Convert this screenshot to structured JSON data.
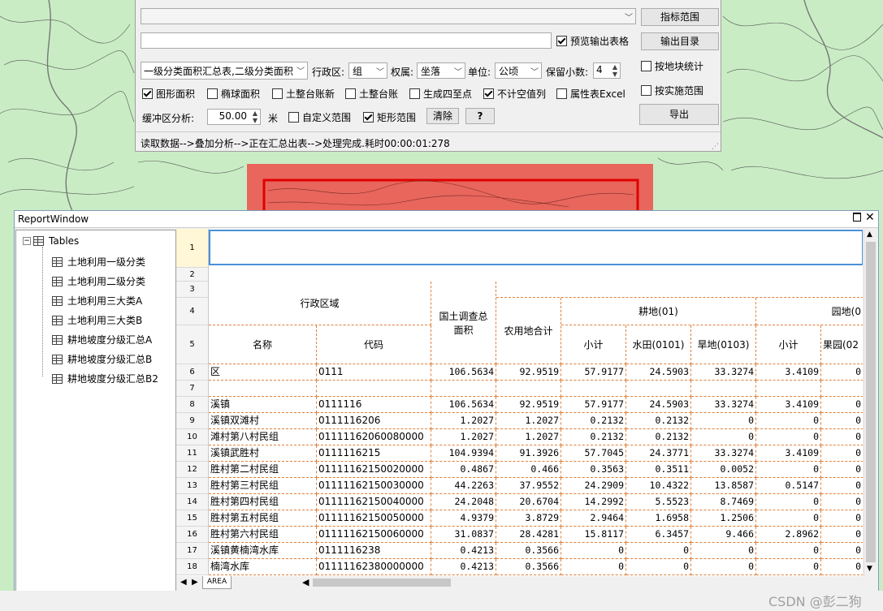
{
  "panel": {
    "preview_checkbox": "预览输出表格",
    "btn_index_range": "指标范围",
    "btn_output_dir": "输出目录",
    "report_select": "一级分类面积汇总表,二级分类面积",
    "admin_label": "行政区:",
    "admin_select": "组",
    "owner_label": "权属:",
    "owner_select": "坐落",
    "unit_label": "单位:",
    "unit_select": "公顷",
    "decimals_label": "保留小数:",
    "decimals_value": "4",
    "cb_block_stats": "按地块统计",
    "cb_shape_area": "图形面积",
    "cb_ellipsoid_area": "椭球面积",
    "cb_land_ledger_new": "土整台账新",
    "cb_land_ledger": "土整台账",
    "cb_four_bounds": "生成四至点",
    "cb_skip_empty": "不计空值列",
    "cb_attr_excel": "属性表Excel",
    "cb_impl_range": "按实施范围",
    "buffer_label": "缓冲区分析:",
    "buffer_value": "50.00",
    "buffer_unit": "米",
    "cb_custom_range": "自定义范围",
    "cb_rect_range": "矩形范围",
    "btn_clear": "清除",
    "btn_help": "?",
    "btn_export": "导出",
    "status": "读取数据-->叠加分析-->正在汇总出表-->处理完成.耗时00:00:01:278"
  },
  "report_window": {
    "title": "ReportWindow",
    "tree_root": "Tables",
    "tree_items": [
      "土地利用一级分类",
      "土地利用二级分类",
      "土地利用三大类A",
      "土地利用三大类B",
      "耕地坡度分级汇总A",
      "耕地坡度分级汇总B",
      "耕地坡度分级汇总B2"
    ],
    "sheet_tab": "AREA"
  },
  "table": {
    "row_numbers": [
      "1",
      "2",
      "3",
      "4",
      "5",
      "6",
      "7",
      "8",
      "9",
      "10",
      "11",
      "12",
      "13",
      "14",
      "15",
      "16",
      "17",
      "18"
    ],
    "h_region": "行政区域",
    "h_name": "名称",
    "h_code": "代码",
    "h_survey": "国土调查总面积",
    "h_agri": "农用地合计",
    "h_arable": "耕地(01)",
    "h_subtotal": "小计",
    "h_paddy": "水田(0101)",
    "h_dry": "旱地(0103)",
    "h_garden": "园地(0",
    "h_subtotal2": "小计",
    "h_orchard": "果园(02",
    "rows": [
      {
        "name": "区",
        "code": "0111",
        "survey": "106.5634",
        "agri": "92.9519",
        "sub": "57.9177",
        "paddy": "24.5903",
        "dry": "33.3274",
        "gsub": "3.4109",
        "orch": "0"
      },
      {
        "name": "",
        "code": "",
        "survey": "",
        "agri": "",
        "sub": "",
        "paddy": "",
        "dry": "",
        "gsub": "",
        "orch": ""
      },
      {
        "name": "溪镇",
        "code": "0111116",
        "survey": "106.5634",
        "agri": "92.9519",
        "sub": "57.9177",
        "paddy": "24.5903",
        "dry": "33.3274",
        "gsub": "3.4109",
        "orch": "0"
      },
      {
        "name": "溪镇双滩村",
        "code": "0111116206",
        "survey": "1.2027",
        "agri": "1.2027",
        "sub": "0.2132",
        "paddy": "0.2132",
        "dry": "0",
        "gsub": "0",
        "orch": "0"
      },
      {
        "name": "滩村第八村民组",
        "code": "01111162060080000",
        "survey": "1.2027",
        "agri": "1.2027",
        "sub": "0.2132",
        "paddy": "0.2132",
        "dry": "0",
        "gsub": "0",
        "orch": "0"
      },
      {
        "name": "溪镇武胜村",
        "code": "0111116215",
        "survey": "104.9394",
        "agri": "91.3926",
        "sub": "57.7045",
        "paddy": "24.3771",
        "dry": "33.3274",
        "gsub": "3.4109",
        "orch": "0"
      },
      {
        "name": "胜村第二村民组",
        "code": "01111162150020000",
        "survey": "0.4867",
        "agri": "0.466",
        "sub": "0.3563",
        "paddy": "0.3511",
        "dry": "0.0052",
        "gsub": "0",
        "orch": "0"
      },
      {
        "name": "胜村第三村民组",
        "code": "01111162150030000",
        "survey": "44.2263",
        "agri": "37.9552",
        "sub": "24.2909",
        "paddy": "10.4322",
        "dry": "13.8587",
        "gsub": "0.5147",
        "orch": "0"
      },
      {
        "name": "胜村第四村民组",
        "code": "01111162150040000",
        "survey": "24.2048",
        "agri": "20.6704",
        "sub": "14.2992",
        "paddy": "5.5523",
        "dry": "8.7469",
        "gsub": "0",
        "orch": "0"
      },
      {
        "name": "胜村第五村民组",
        "code": "01111162150050000",
        "survey": "4.9379",
        "agri": "3.8729",
        "sub": "2.9464",
        "paddy": "1.6958",
        "dry": "1.2506",
        "gsub": "0",
        "orch": "0"
      },
      {
        "name": "胜村第六村民组",
        "code": "01111162150060000",
        "survey": "31.0837",
        "agri": "28.4281",
        "sub": "15.8117",
        "paddy": "6.3457",
        "dry": "9.466",
        "gsub": "2.8962",
        "orch": "0"
      },
      {
        "name": "溪镇黄楠湾水库",
        "code": "0111116238",
        "survey": "0.4213",
        "agri": "0.3566",
        "sub": "0",
        "paddy": "0",
        "dry": "0",
        "gsub": "0",
        "orch": "0"
      },
      {
        "name": "楠湾水库",
        "code": "01111162380000000",
        "survey": "0.4213",
        "agri": "0.3566",
        "sub": "0",
        "paddy": "0",
        "dry": "0",
        "gsub": "0",
        "orch": "0"
      }
    ]
  },
  "watermark": "CSDN @彭二狗"
}
